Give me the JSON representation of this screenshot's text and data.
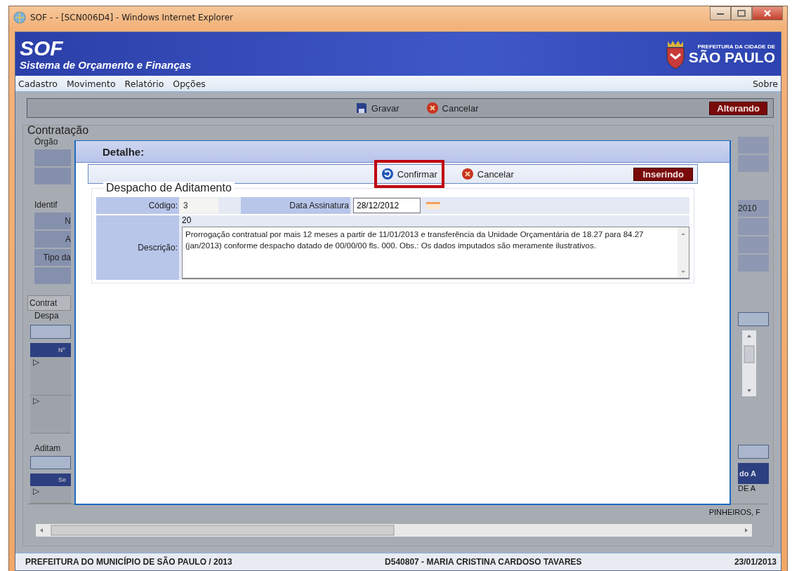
{
  "window": {
    "title": "SOF - - [SCN006D4] - Windows Internet Explorer"
  },
  "header": {
    "app_name": "SOF",
    "app_subtitle": "Sistema de Orçamento e Finanças",
    "org_line1": "PREFEITURA DA CIDADE DE",
    "org_line2": "SÃO PAULO"
  },
  "menu": {
    "items": [
      "Cadastro",
      "Movimento",
      "Relatório",
      "Opções"
    ],
    "right_item": "Sobre"
  },
  "toolbar": {
    "buttons": [
      {
        "label": "Gravar",
        "kind": "save"
      },
      {
        "label": "Cancelar",
        "kind": "cancel"
      }
    ],
    "mode": "Alterando"
  },
  "background_form": {
    "section_title": "Contratação",
    "left_sections": [
      [
        {
          "kind": "label",
          "text": "Órgão"
        },
        {
          "kind": "row"
        },
        {
          "kind": "row"
        }
      ],
      [
        {
          "kind": "label",
          "text": "Identif"
        },
        {
          "kind": "row",
          "text": "N"
        },
        {
          "kind": "row",
          "text": "A"
        },
        {
          "kind": "row",
          "text": "Tipo da"
        },
        {
          "kind": "row"
        }
      ],
      [
        {
          "kind": "tab",
          "text": "Contrat"
        },
        {
          "kind": "label",
          "text": "Despa"
        },
        {
          "kind": "bar"
        },
        {
          "kind": "header",
          "text": "Nº"
        },
        {
          "kind": "tree",
          "text": "▷"
        },
        {
          "kind": "tree",
          "text": "▷"
        }
      ],
      [
        {
          "kind": "label",
          "text": "Aditam"
        },
        {
          "kind": "bar"
        },
        {
          "kind": "header",
          "text": "Se"
        },
        {
          "kind": "tree",
          "text": "▷"
        }
      ]
    ],
    "right_sections": [
      [
        {
          "kind": "row"
        },
        {
          "kind": "row"
        }
      ],
      [
        {
          "kind": "row",
          "text": "2010"
        },
        {
          "kind": "row"
        },
        {
          "kind": "row"
        },
        {
          "kind": "row"
        }
      ],
      [
        {
          "kind": "spacer-tab"
        },
        {
          "kind": "bar"
        },
        {
          "kind": "scroll"
        }
      ],
      [
        {
          "kind": "bar"
        },
        {
          "kind": "header",
          "text": "do A"
        },
        {
          "kind": "cell",
          "text": "DE A"
        }
      ]
    ],
    "bottom_cell": "PINHEIROS, F"
  },
  "dialog": {
    "title": "Detalhe:",
    "buttons": [
      {
        "label": "Confirmar",
        "kind": "confirm",
        "highlighted": true
      },
      {
        "label": "Cancelar",
        "kind": "cancel",
        "highlighted": false
      }
    ],
    "mode": "Inserindo",
    "group_title": "Despacho de Aditamento",
    "codigo_label": "Código:",
    "codigo_value": "3",
    "data_label": "Data Assinatura",
    "data_value": "28/12/2012",
    "char_count": "20",
    "descricao_label": "Descrição:",
    "descricao_value": "Prorrogação contratual por mais 12 meses a partir de 11/01/2013 e transferência da Unidade Orçamentária de 18.27 para 84.27 (jan/2013) conforme despacho datado de 00/00/00 fls. 000. Obs.: Os dados  imputados são meramente ilustrativos."
  },
  "status_bar": [
    "PREFEITURA DO MUNICÍPIO DE SÃO PAULO / 2013",
    "D540807 - MARIA CRISTINA CARDOSO TAVARES",
    "23/01/2013"
  ]
}
